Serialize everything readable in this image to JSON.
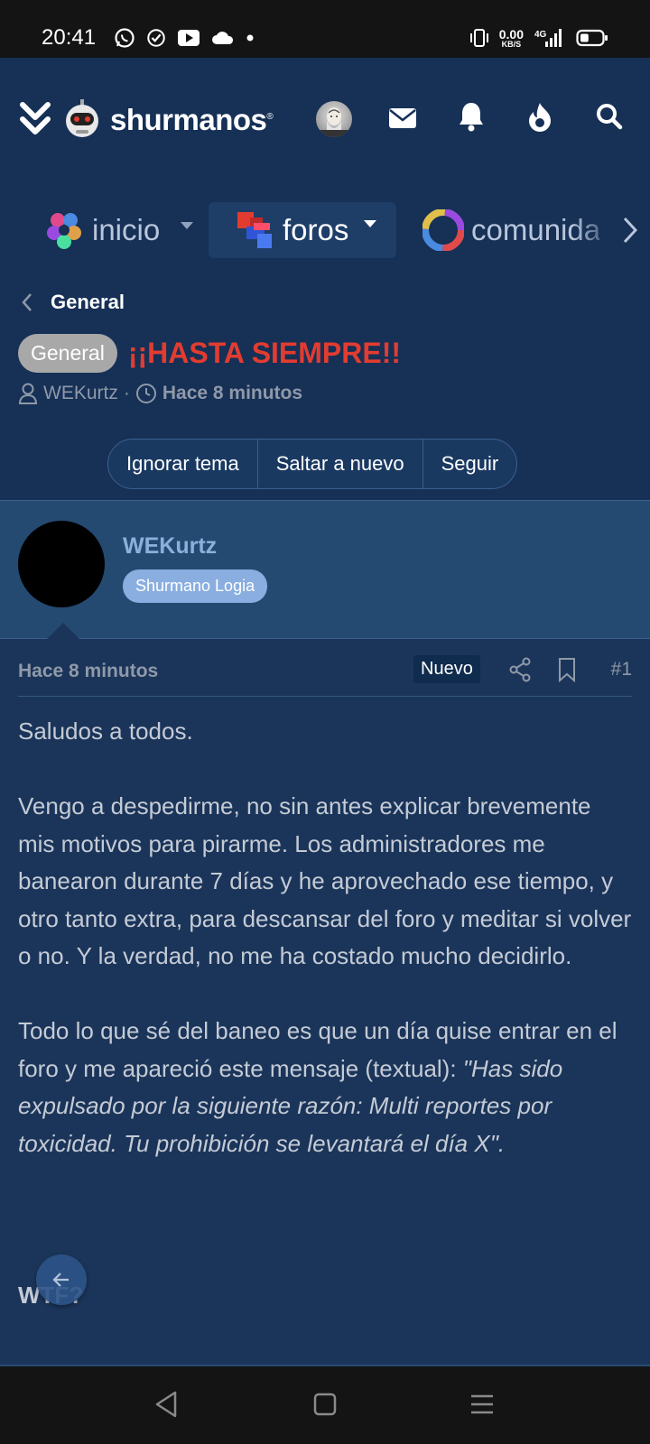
{
  "status_bar": {
    "time": "20:41",
    "icons": [
      "whatsapp-icon",
      "check-circle-icon",
      "youtube-icon",
      "cloud-icon",
      "dot-icon"
    ],
    "net_speed_value": "0.00",
    "net_speed_unit": "KB/S",
    "network": "4G",
    "battery_level": 0.4
  },
  "header": {
    "logo_text": "shurmanos",
    "logo_mark": "®",
    "icons": [
      "menu-chevrons-icon",
      "robot-logo-icon",
      "avatar",
      "mail-icon",
      "bell-icon",
      "fire-icon",
      "search-icon"
    ]
  },
  "nav": {
    "tabs": [
      {
        "label": "inicio",
        "active": false
      },
      {
        "label": "foros",
        "active": true
      },
      {
        "label": "comunidad",
        "active": false
      }
    ]
  },
  "breadcrumb": {
    "label": "General"
  },
  "thread": {
    "tag": "General",
    "title": "¡¡HASTA SIEMPRE!!",
    "author": "WEKurtz",
    "separator": "·",
    "time": "Hace 8 minutos"
  },
  "actions": {
    "ignore": "Ignorar tema",
    "jump": "Saltar a nuevo",
    "follow": "Seguir"
  },
  "post": {
    "username": "WEKurtz",
    "role": "Shurmano Logia",
    "time": "Hace 8 minutos",
    "badge": "Nuevo",
    "number": "#1",
    "p1": "Saludos a todos.",
    "p2": "Vengo a despedirme, no sin antes explicar brevemente mis motivos para pirarme. Los administradores me banearon durante 7 días y he aprovechado ese tiempo, y otro tanto extra, para descansar del foro y meditar si volver o no. Y la verdad, no me ha costado mucho decidirlo.",
    "p3_intro": "Todo lo que sé del baneo es que un día quise entrar en el foro y me apareció este mensaje (textual): ",
    "p3_quote": "\"Has sido expulsado por la siguiente razón: Multi reportes por toxicidad. Tu prohibición se levantará el día X\".",
    "p4": "WTF?"
  },
  "colors": {
    "accent_red": "#e23c30",
    "header_bg": "#163056",
    "body_bg": "#1b355a",
    "user_block_bg": "#254a71",
    "role_badge": "#8aaee0"
  }
}
